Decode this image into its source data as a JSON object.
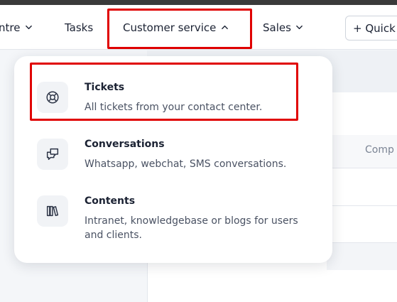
{
  "navbar": {
    "items": [
      {
        "label": "ntre",
        "icon": "chevron-down-icon"
      },
      {
        "label": "Tasks"
      },
      {
        "label": "Customer service",
        "icon": "chevron-up-icon"
      },
      {
        "label": "Sales",
        "icon": "chevron-down-icon"
      }
    ],
    "quick_add_label": "+ Quick a"
  },
  "table": {
    "column_header": "Comp"
  },
  "dropdown": {
    "items": [
      {
        "title": "Tickets",
        "description": "All tickets from your contact center.",
        "icon": "lifebuoy-icon"
      },
      {
        "title": "Conversations",
        "description": "Whatsapp, webchat, SMS conversations.",
        "icon": "chat-bubbles-icon"
      },
      {
        "title": "Contents",
        "description": "Intranet, knowledgebase or blogs for users and clients.",
        "icon": "books-icon"
      }
    ]
  },
  "colors": {
    "highlight": "#e00000",
    "text": "#1b2233",
    "muted": "#4a5263"
  }
}
